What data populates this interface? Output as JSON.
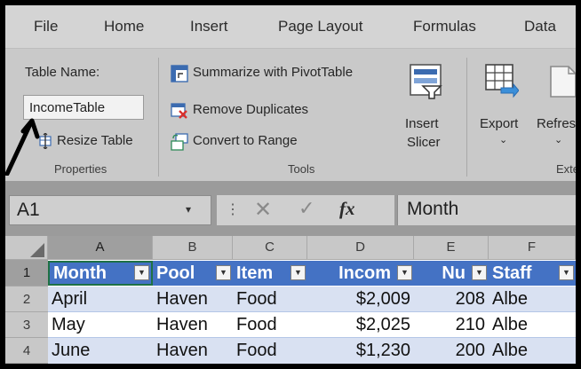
{
  "menu": {
    "items": [
      "File",
      "Home",
      "Insert",
      "Page Layout",
      "Formulas",
      "Data"
    ]
  },
  "ribbon": {
    "properties": {
      "table_name_label": "Table Name:",
      "table_name_value": "IncomeTable",
      "resize_label": "Resize Table",
      "group_label": "Properties"
    },
    "tools": {
      "summarize_label": "Summarize with PivotTable",
      "remove_duplicates_label": "Remove Duplicates",
      "convert_label": "Convert to Range",
      "group_label": "Tools"
    },
    "insert_slicer": {
      "line1": "Insert",
      "line2": "Slicer"
    },
    "export": {
      "label": "Export"
    },
    "refresh": {
      "label": "Refres"
    },
    "external_group_label": "Exte"
  },
  "formula_bar": {
    "name_box": "A1",
    "cancel_symbol": "✕",
    "enter_symbol": "✓",
    "fx_symbol": "fx",
    "value": "Month"
  },
  "grid": {
    "column_letters": [
      "A",
      "B",
      "C",
      "D",
      "E",
      "F"
    ],
    "row_numbers": [
      "1",
      "2",
      "3",
      "4"
    ],
    "table_headers": [
      "Month",
      "Pool",
      "Item",
      "Incom",
      "Nu",
      "Staff"
    ],
    "rows": [
      [
        "April",
        "Haven",
        "Food",
        "$2,009",
        "208",
        "Albe"
      ],
      [
        "May",
        "Haven",
        "Food",
        "$2,025",
        "210",
        "Albe"
      ],
      [
        "June",
        "Haven",
        "Food",
        "$1,230",
        "200",
        "Albe"
      ]
    ]
  },
  "colors": {
    "table_header": "#4472c4",
    "band_light": "#d9e1f2",
    "band_white": "#ffffff",
    "annotation_arrow": "#000000"
  },
  "icons": {
    "annotation": "arrow-annotation",
    "resize": "resize-table-icon",
    "pivot": "pivot-table-icon",
    "duplicates": "remove-duplicates-icon",
    "convert": "convert-to-range-icon",
    "slicer": "slicer-icon",
    "export": "export-icon",
    "refresh": "refresh-icon"
  }
}
